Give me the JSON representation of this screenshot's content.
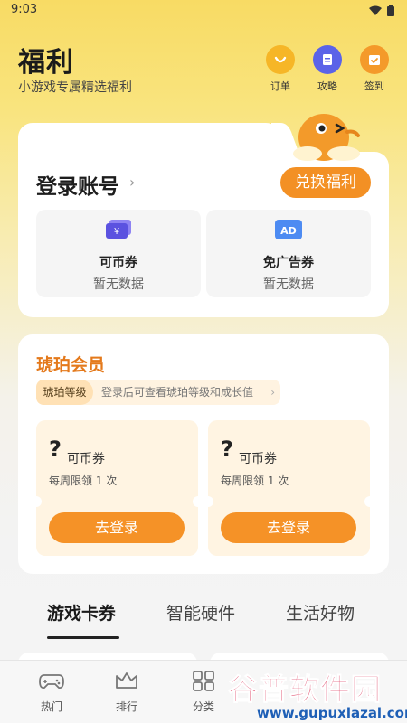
{
  "status_bar": {
    "time": "9:03"
  },
  "header": {
    "title": "福利",
    "subtitle": "小游戏专属精选福利",
    "actions": [
      {
        "label": "订单",
        "icon": "order-icon",
        "color": "#F6B627"
      },
      {
        "label": "攻略",
        "icon": "guide-icon",
        "color": "#5B63E8"
      },
      {
        "label": "签到",
        "icon": "checkin-icon",
        "color": "#F49A2A"
      }
    ]
  },
  "account": {
    "login_title": "登录账号",
    "redeem_label": "兑换福利",
    "tiles": [
      {
        "name": "可币券",
        "value": "暂无数据",
        "icon": "coin-ticket-icon"
      },
      {
        "name": "免广告券",
        "value": "暂无数据",
        "icon": "ad-free-icon",
        "icon_text": "AD"
      }
    ]
  },
  "amber": {
    "title": "琥珀会员",
    "level_label": "琥珀等级",
    "level_hint": "登录后可查看琥珀等级和成长值",
    "coupons": [
      {
        "mark": "?",
        "name": "可币券",
        "limit": "每周限领 1 次",
        "button": "去登录"
      },
      {
        "mark": "?",
        "name": "可币券",
        "limit": "每周限领 1 次",
        "button": "去登录"
      }
    ]
  },
  "category_tabs": [
    "游戏卡券",
    "智能硬件",
    "生活好物"
  ],
  "active_tab": "游戏卡券",
  "bottom_nav": [
    {
      "label": "热门",
      "icon": "gamepad-icon"
    },
    {
      "label": "排行",
      "icon": "crown-icon"
    },
    {
      "label": "分类",
      "icon": "grid-icon"
    }
  ],
  "watermark": {
    "brand": "谷普软件园",
    "url": "www.gupuxlazal.com"
  },
  "colors": {
    "accent": "#F39024",
    "amber_text": "#E4791B",
    "header_bg": "#F8DB64"
  }
}
